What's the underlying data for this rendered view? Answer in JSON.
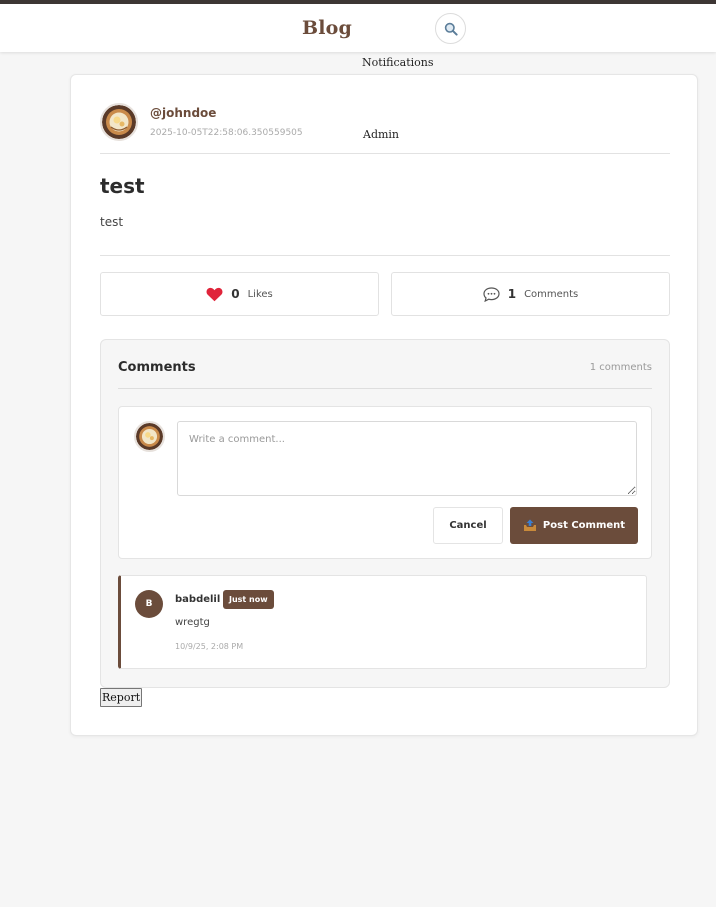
{
  "header": {
    "brand": "Blog",
    "notifications_label": "Notifications",
    "search_icon": "magnifier-icon"
  },
  "post": {
    "author": {
      "username": "@johndoe",
      "timestamp": "2025-10-05T22:58:06.350559505",
      "role": "Admin",
      "avatar_icon": "food-photo-avatar"
    },
    "title": "test",
    "body": "test",
    "likes": {
      "count": "0",
      "label": "Likes",
      "icon": "heart-icon"
    },
    "comments_stat": {
      "count": "1",
      "label": "Comments",
      "icon": "speech-bubble-icon"
    }
  },
  "comments": {
    "title": "Comments",
    "count_label": "1 comments",
    "compose": {
      "placeholder": "Write a comment...",
      "value": "",
      "cancel_label": "Cancel",
      "post_label": "Post Comment",
      "post_icon": "outbox-tray-icon"
    },
    "items": [
      {
        "avatar_initial": "B",
        "author": "babdelil",
        "badge": "Just now",
        "text": "wregtg",
        "time": "10/9/25, 2:08 PM"
      }
    ]
  },
  "report_label": "Report",
  "colors": {
    "accent": "#6b4c3b",
    "topbar_border": "#3d3634",
    "background": "#f6f6f6"
  }
}
